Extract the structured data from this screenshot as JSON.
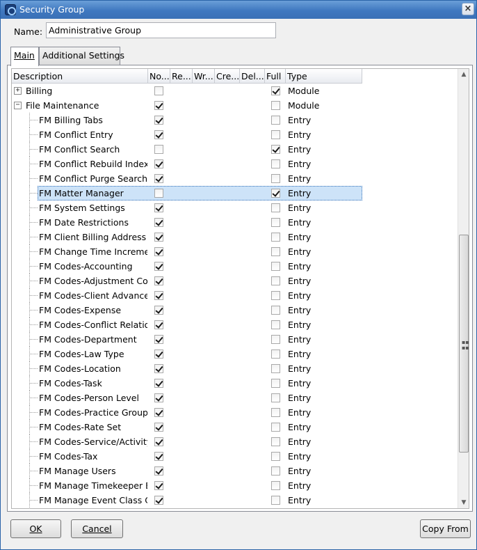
{
  "window": {
    "title": "Security Group",
    "icon": "app-icon",
    "close_symbol": "×"
  },
  "name_field": {
    "label": "Name:",
    "value": "Administrative Group"
  },
  "tabs": [
    {
      "label": "Main",
      "active": true
    },
    {
      "label": "Additional Settings",
      "active": false
    }
  ],
  "grid": {
    "columns": [
      "Description",
      "No...",
      "Re...",
      "Wr...",
      "Cre...",
      "Del...",
      "Full",
      "Type"
    ],
    "rows": [
      {
        "description": "Billing",
        "level": 0,
        "expander": "+",
        "no": false,
        "full": true,
        "type": "Module",
        "selected": false
      },
      {
        "description": "File Maintenance",
        "level": 0,
        "expander": "−",
        "no": true,
        "full": false,
        "type": "Module",
        "selected": false
      },
      {
        "description": "FM Billing Tabs",
        "level": 1,
        "no": true,
        "full": false,
        "type": "Entry",
        "selected": false
      },
      {
        "description": "FM Conflict Entry",
        "level": 1,
        "no": true,
        "full": false,
        "type": "Entry",
        "selected": false
      },
      {
        "description": "FM Conflict Search",
        "level": 1,
        "no": false,
        "full": true,
        "type": "Entry",
        "selected": false
      },
      {
        "description": "FM Conflict Rebuild Index",
        "level": 1,
        "no": true,
        "full": false,
        "type": "Entry",
        "selected": false
      },
      {
        "description": "FM Conflict Purge Search History",
        "level": 1,
        "no": true,
        "full": false,
        "type": "Entry",
        "selected": false
      },
      {
        "description": "FM Matter Manager",
        "level": 1,
        "no": false,
        "full": true,
        "type": "Entry",
        "selected": true
      },
      {
        "description": "FM System Settings",
        "level": 1,
        "no": true,
        "full": false,
        "type": "Entry",
        "selected": false
      },
      {
        "description": "FM Date Restrictions",
        "level": 1,
        "no": true,
        "full": false,
        "type": "Entry",
        "selected": false
      },
      {
        "description": "FM Client Billing Address",
        "level": 1,
        "no": true,
        "full": false,
        "type": "Entry",
        "selected": false
      },
      {
        "description": "FM Change Time Increment",
        "level": 1,
        "no": true,
        "full": false,
        "type": "Entry",
        "selected": false
      },
      {
        "description": "FM Codes-Accounting",
        "level": 1,
        "no": true,
        "full": false,
        "type": "Entry",
        "selected": false
      },
      {
        "description": "FM Codes-Adjustment Codes",
        "level": 1,
        "no": true,
        "full": false,
        "type": "Entry",
        "selected": false
      },
      {
        "description": "FM Codes-Client Advance",
        "level": 1,
        "no": true,
        "full": false,
        "type": "Entry",
        "selected": false
      },
      {
        "description": "FM Codes-Expense",
        "level": 1,
        "no": true,
        "full": false,
        "type": "Entry",
        "selected": false
      },
      {
        "description": "FM Codes-Conflict Relationship",
        "level": 1,
        "no": true,
        "full": false,
        "type": "Entry",
        "selected": false
      },
      {
        "description": "FM Codes-Department",
        "level": 1,
        "no": true,
        "full": false,
        "type": "Entry",
        "selected": false
      },
      {
        "description": "FM Codes-Law Type",
        "level": 1,
        "no": true,
        "full": false,
        "type": "Entry",
        "selected": false
      },
      {
        "description": "FM Codes-Location",
        "level": 1,
        "no": true,
        "full": false,
        "type": "Entry",
        "selected": false
      },
      {
        "description": "FM Codes-Task",
        "level": 1,
        "no": true,
        "full": false,
        "type": "Entry",
        "selected": false
      },
      {
        "description": "FM Codes-Person Level",
        "level": 1,
        "no": true,
        "full": false,
        "type": "Entry",
        "selected": false
      },
      {
        "description": "FM Codes-Practice Group",
        "level": 1,
        "no": true,
        "full": false,
        "type": "Entry",
        "selected": false
      },
      {
        "description": "FM Codes-Rate Set",
        "level": 1,
        "no": true,
        "full": false,
        "type": "Entry",
        "selected": false
      },
      {
        "description": "FM Codes-Service/Activity",
        "level": 1,
        "no": true,
        "full": false,
        "type": "Entry",
        "selected": false
      },
      {
        "description": "FM Codes-Tax",
        "level": 1,
        "no": true,
        "full": false,
        "type": "Entry",
        "selected": false
      },
      {
        "description": "FM Manage Users",
        "level": 1,
        "no": true,
        "full": false,
        "type": "Entry",
        "selected": false
      },
      {
        "description": "FM Manage Timekeeper Billing",
        "level": 1,
        "no": true,
        "full": false,
        "type": "Entry",
        "selected": false
      },
      {
        "description": "FM Manage Event Class Codes",
        "level": 1,
        "no": true,
        "full": false,
        "type": "Entry",
        "selected": false
      }
    ]
  },
  "buttons": {
    "ok": "OK",
    "cancel": "Cancel",
    "copy_from": "Copy From"
  }
}
